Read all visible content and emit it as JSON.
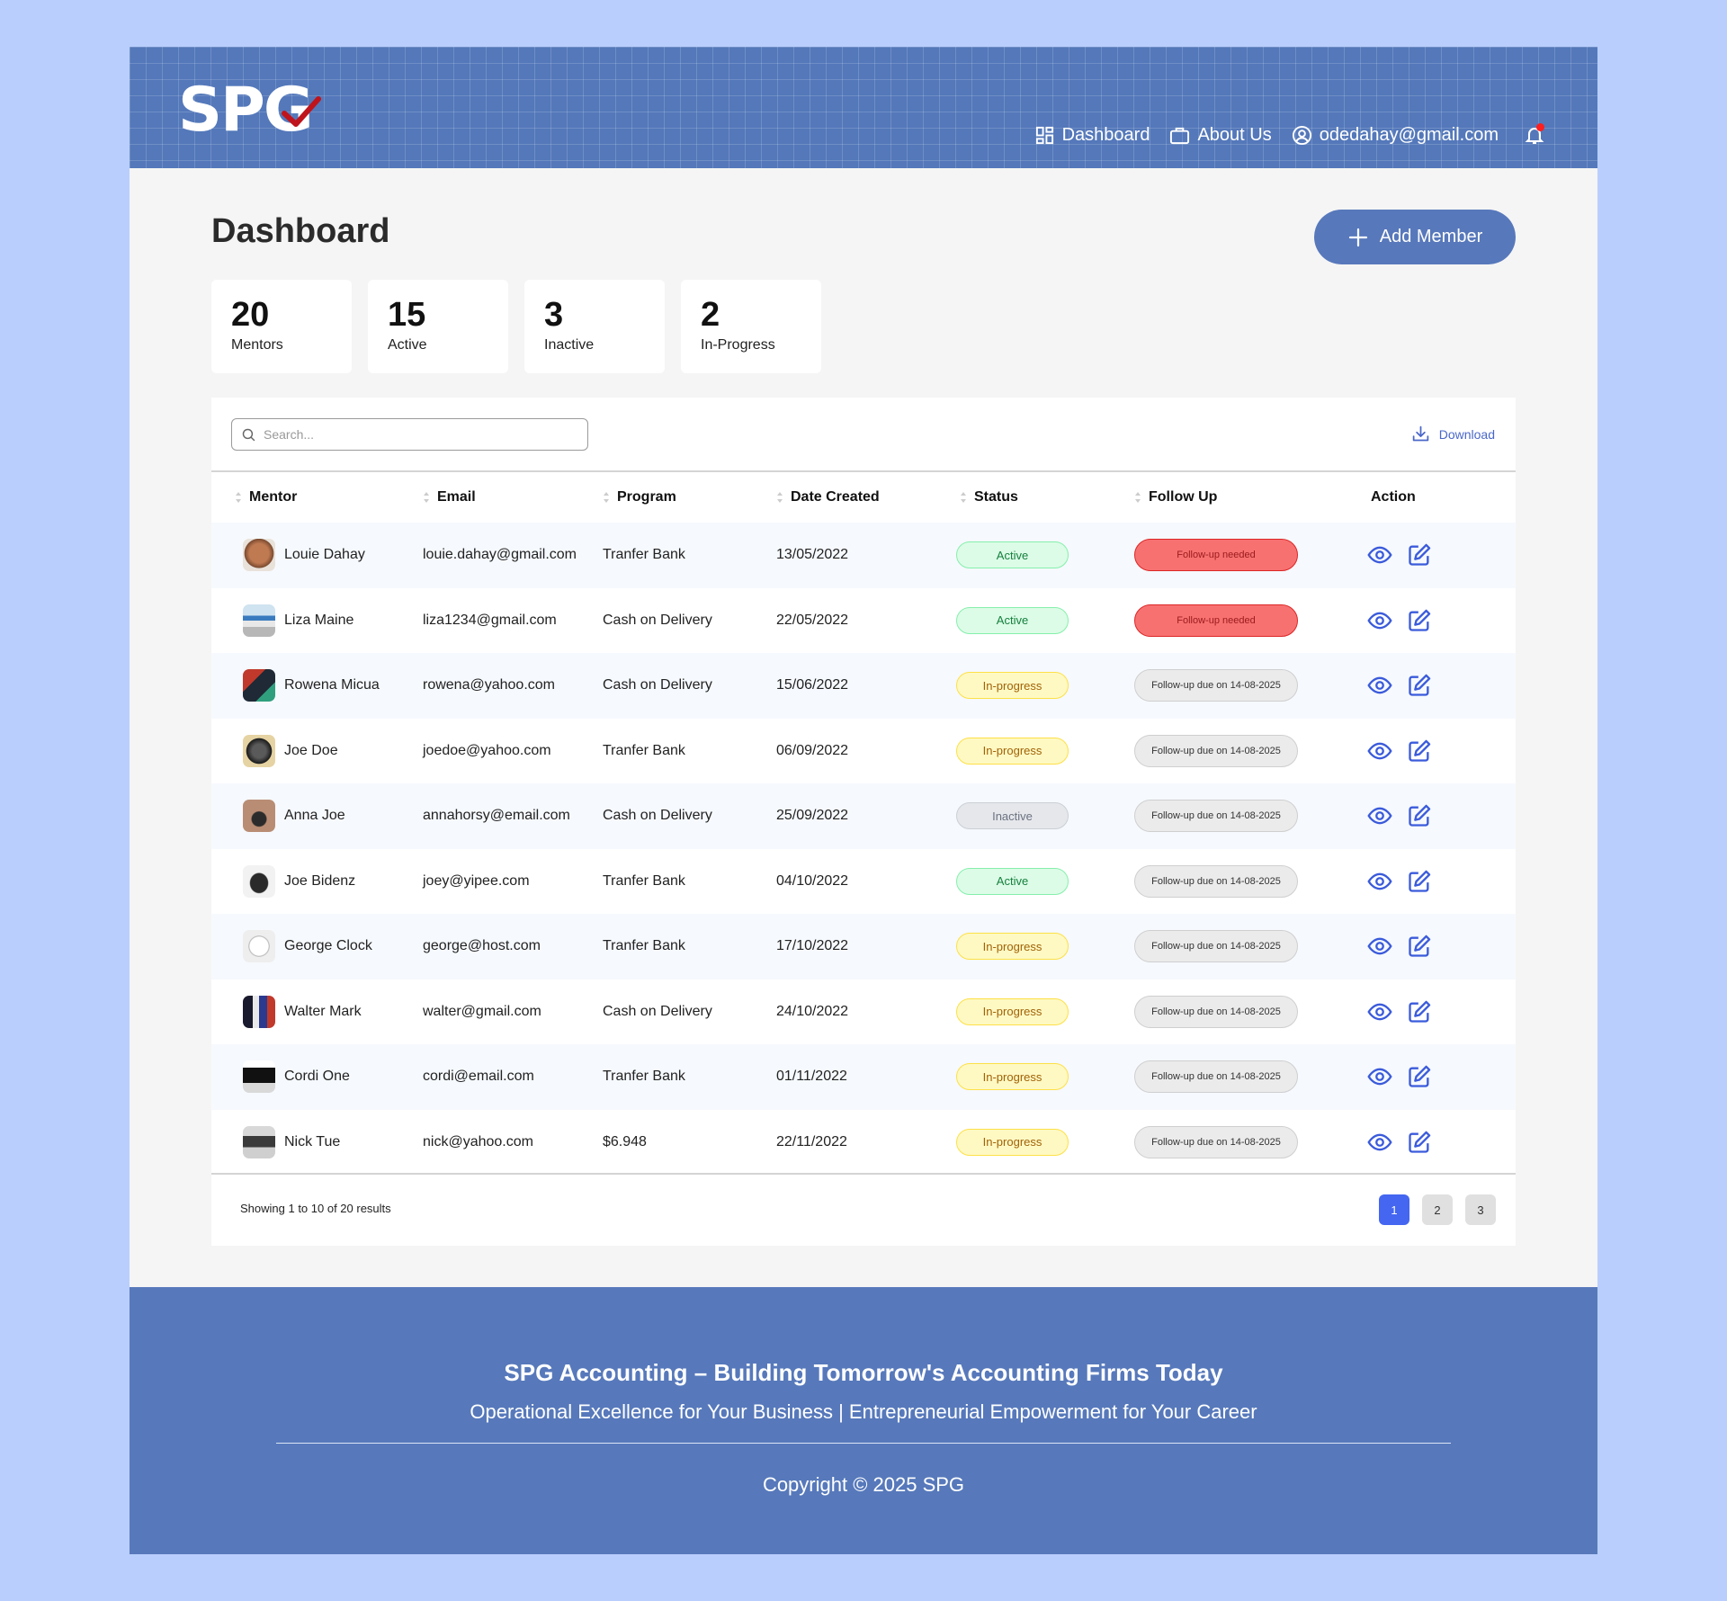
{
  "brand": {
    "logo_text": "SPG",
    "check_color": "#c0141c"
  },
  "nav": {
    "dashboard": "Dashboard",
    "about": "About Us",
    "account": "odedahay@gmail.com"
  },
  "page": {
    "title": "Dashboard",
    "add_member": "Add Member"
  },
  "stats": [
    {
      "value": "20",
      "label": "Mentors"
    },
    {
      "value": "15",
      "label": "Active"
    },
    {
      "value": "3",
      "label": "Inactive"
    },
    {
      "value": "2",
      "label": "In-Progress"
    }
  ],
  "toolbar": {
    "search_placeholder": "Search...",
    "download": "Download"
  },
  "table": {
    "headers": {
      "mentor": "Mentor",
      "email": "Email",
      "program": "Program",
      "date": "Date Created",
      "status": "Status",
      "follow": "Follow Up",
      "action": "Action"
    },
    "rows": [
      {
        "name": "Louie Dahay",
        "email": "louie.dahay@gmail.com",
        "program": "Tranfer Bank",
        "date": "13/05/2022",
        "status": "Active",
        "follow": "Follow-up needed"
      },
      {
        "name": "Liza Maine",
        "email": "liza1234@gmail.com",
        "program": "Cash on Delivery",
        "date": "22/05/2022",
        "status": "Active",
        "follow": "Follow-up needed"
      },
      {
        "name": "Rowena Micua",
        "email": "rowena@yahoo.com",
        "program": "Cash on Delivery",
        "date": "15/06/2022",
        "status": "In-progress",
        "follow": "Follow-up due on 14-08-2025"
      },
      {
        "name": "Joe Doe",
        "email": "joedoe@yahoo.com",
        "program": "Tranfer Bank",
        "date": "06/09/2022",
        "status": "In-progress",
        "follow": "Follow-up due on 14-08-2025"
      },
      {
        "name": "Anna Joe",
        "email": "annahorsy@email.com",
        "program": "Cash on Delivery",
        "date": "25/09/2022",
        "status": "Inactive",
        "follow": "Follow-up due on 14-08-2025"
      },
      {
        "name": "Joe Bidenz",
        "email": "joey@yipee.com",
        "program": "Tranfer Bank",
        "date": "04/10/2022",
        "status": "Active",
        "follow": "Follow-up due on 14-08-2025"
      },
      {
        "name": "George Clock",
        "email": "george@host.com",
        "program": "Tranfer Bank",
        "date": "17/10/2022",
        "status": "In-progress",
        "follow": "Follow-up due on 14-08-2025"
      },
      {
        "name": "Walter Mark",
        "email": "walter@gmail.com",
        "program": "Cash on Delivery",
        "date": "24/10/2022",
        "status": "In-progress",
        "follow": "Follow-up due on 14-08-2025"
      },
      {
        "name": "Cordi One",
        "email": "cordi@email.com",
        "program": "Tranfer Bank",
        "date": "01/11/2022",
        "status": "In-progress",
        "follow": "Follow-up due on 14-08-2025"
      },
      {
        "name": "Nick Tue",
        "email": "nick@yahoo.com",
        "program": "$6.948",
        "date": "22/11/2022",
        "status": "In-progress",
        "follow": "Follow-up due on 14-08-2025"
      }
    ]
  },
  "pagination": {
    "showing": "Showing 1 to 10 of 20 results",
    "pages": [
      "1",
      "2",
      "3"
    ],
    "current": "1"
  },
  "footer": {
    "title": "SPG Accounting – Building Tomorrow's Accounting Firms Today",
    "subtitle": "Operational Excellence for Your Business | Entrepreneurial Empowerment for Your Career",
    "copyright": "Copyright © 2025 SPG"
  },
  "colors": {
    "background": "#b9cefc",
    "header": "#5478ba",
    "accent": "#5778bb",
    "link": "#4a67c9",
    "page_current": "#4466f0"
  }
}
